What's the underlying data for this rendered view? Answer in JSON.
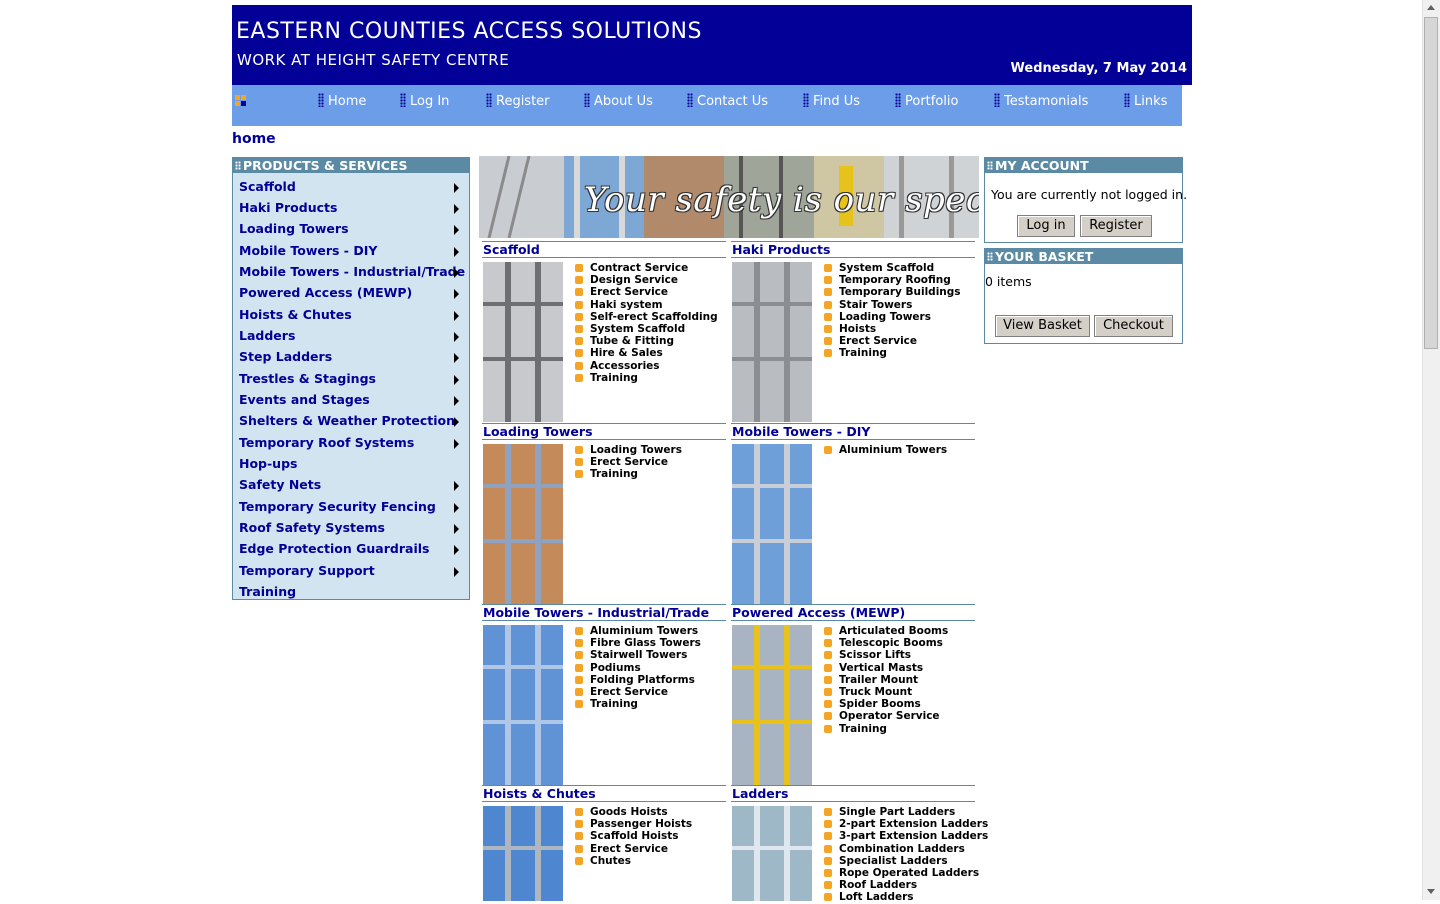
{
  "header": {
    "line1": "EASTERN COUNTIES ACCESS SOLUTIONS",
    "line2": "WORK AT HEIGHT SAFETY CENTRE",
    "date": "Wednesday, 7 May 2014",
    "colors": {
      "header_bg": "#020096",
      "nav_bg": "#6c9de8"
    }
  },
  "nav": {
    "items": [
      {
        "label": "Home"
      },
      {
        "label": "Log In"
      },
      {
        "label": "Register"
      },
      {
        "label": "About Us"
      },
      {
        "label": "Contact Us"
      },
      {
        "label": "Find Us"
      },
      {
        "label": "Portfolio"
      },
      {
        "label": "Testamonials"
      },
      {
        "label": "Links"
      }
    ]
  },
  "breadcrumb": "home",
  "left": {
    "title": "PRODUCTS & SERVICES",
    "items": [
      {
        "label": "Scaffold",
        "arrow": true
      },
      {
        "label": "Haki Products",
        "arrow": true
      },
      {
        "label": "Loading Towers",
        "arrow": true
      },
      {
        "label": "Mobile Towers - DIY",
        "arrow": true
      },
      {
        "label": "Mobile Towers - Industrial/Trade",
        "arrow": true
      },
      {
        "label": "Powered Access (MEWP)",
        "arrow": true
      },
      {
        "label": "Hoists & Chutes",
        "arrow": true
      },
      {
        "label": "Ladders",
        "arrow": true
      },
      {
        "label": "Step Ladders",
        "arrow": true
      },
      {
        "label": "Trestles & Stagings",
        "arrow": true
      },
      {
        "label": "Events and Stages",
        "arrow": true
      },
      {
        "label": "Shelters & Weather Protection",
        "arrow": true
      },
      {
        "label": "Temporary Roof Systems",
        "arrow": true
      },
      {
        "label": "Hop-ups",
        "arrow": false
      },
      {
        "label": "Safety Nets",
        "arrow": true
      },
      {
        "label": "Temporary Security Fencing",
        "arrow": true
      },
      {
        "label": "Roof Safety Systems",
        "arrow": true
      },
      {
        "label": "Edge Protection Guardrails",
        "arrow": true
      },
      {
        "label": "Temporary Support",
        "arrow": true
      },
      {
        "label": "Training",
        "arrow": false
      }
    ]
  },
  "banner": {
    "text": "Your safety is our speciality"
  },
  "products": [
    {
      "title": "Scaffold",
      "items": [
        "Contract Service",
        "Design Service",
        "Erect Service",
        "Haki system",
        "Self-erect Scaffolding",
        "System Scaffold",
        "Tube & Fitting",
        "Hire & Sales",
        "Accessories",
        "Training"
      ]
    },
    {
      "title": "Haki Products",
      "items": [
        "System Scaffold",
        "Temporary Roofing",
        "Temporary Buildings",
        "Stair Towers",
        "Loading Towers",
        "Hoists",
        "Erect Service",
        "Training"
      ]
    },
    {
      "title": "Loading Towers",
      "items": [
        "Loading Towers",
        "Erect Service",
        "Training"
      ]
    },
    {
      "title": "Mobile Towers - DIY",
      "items": [
        "Aluminium Towers"
      ]
    },
    {
      "title": "Mobile Towers - Industrial/Trade",
      "items": [
        "Aluminium Towers",
        "Fibre Glass Towers",
        "Stairwell Towers",
        "Podiums",
        "Folding Platforms",
        "Erect Service",
        "Training"
      ]
    },
    {
      "title": "Powered Access (MEWP)",
      "items": [
        "Articulated Booms",
        "Telescopic Booms",
        "Scissor Lifts",
        "Vertical Masts",
        "Trailer Mount",
        "Truck Mount",
        "Spider Booms",
        "Operator Service",
        "Training"
      ]
    },
    {
      "title": "Hoists & Chutes",
      "items": [
        "Goods Hoists",
        "Passenger Hoists",
        "Scaffold Hoists",
        "Erect Service",
        "Chutes"
      ]
    },
    {
      "title": "Ladders",
      "items": [
        "Single Part Ladders",
        "2-part Extension Ladders",
        "3-part Extension Ladders",
        "Combination Ladders",
        "Specialist Ladders",
        "Rope Operated Ladders",
        "Roof Ladders",
        "Loft Ladders"
      ]
    }
  ],
  "account": {
    "title": "MY ACCOUNT",
    "status": "You are currently not logged in.",
    "login_label": "Log in",
    "register_label": "Register"
  },
  "basket": {
    "title": "YOUR BASKET",
    "count": "0 items",
    "view_label": "View Basket",
    "checkout_label": "Checkout"
  }
}
